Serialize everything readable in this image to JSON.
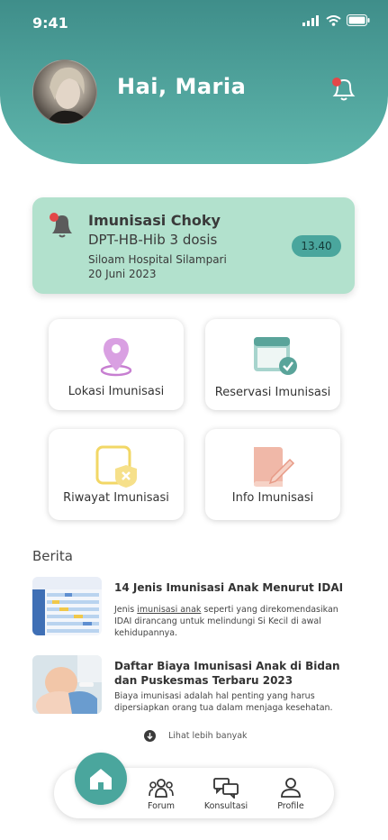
{
  "status_bar": {
    "time": "9:41"
  },
  "header": {
    "greeting": "Hai, Maria"
  },
  "reminder": {
    "title": "Imunisasi Choky",
    "vaccine": "DPT-HB-Hib 3 dosis",
    "location": "Siloam Hospital Silampari",
    "date": "20 Juni 2023",
    "time": "13.40"
  },
  "menu": [
    {
      "label": "Lokasi Imunisasi",
      "icon": "location-pin-icon"
    },
    {
      "label": "Reservasi Imunisasi",
      "icon": "calendar-check-icon"
    },
    {
      "label": "Riwayat Imunisasi",
      "icon": "shield-x-icon"
    },
    {
      "label": "Info Imunisasi",
      "icon": "book-pen-icon"
    }
  ],
  "news_section": {
    "heading": "Berita",
    "items": [
      {
        "title": "14 Jenis Imunisasi Anak Menurut IDAI",
        "desc_pre": "Jenis ",
        "desc_link": "imunisasi anak",
        "desc_post": " seperti yang direkomendasikan IDAI dirancang untuk melindungi Si Kecil di awal kehidupannya."
      },
      {
        "title": "Daftar Biaya Imunisasi Anak di Bidan dan Puskesmas Terbaru 2023",
        "desc": "Biaya imunisasi adalah hal penting yang harus dipersiapkan orang tua dalam menjaga kesehatan."
      }
    ],
    "more_label": "Lihat lebih banyak"
  },
  "bottom_nav": {
    "items": [
      {
        "label": "Forum"
      },
      {
        "label": "Konsultasi"
      },
      {
        "label": "Profile"
      }
    ]
  },
  "colors": {
    "teal": "#4aa69d",
    "reminder_bg": "#b2e1cd",
    "accent_red": "#e24848"
  }
}
